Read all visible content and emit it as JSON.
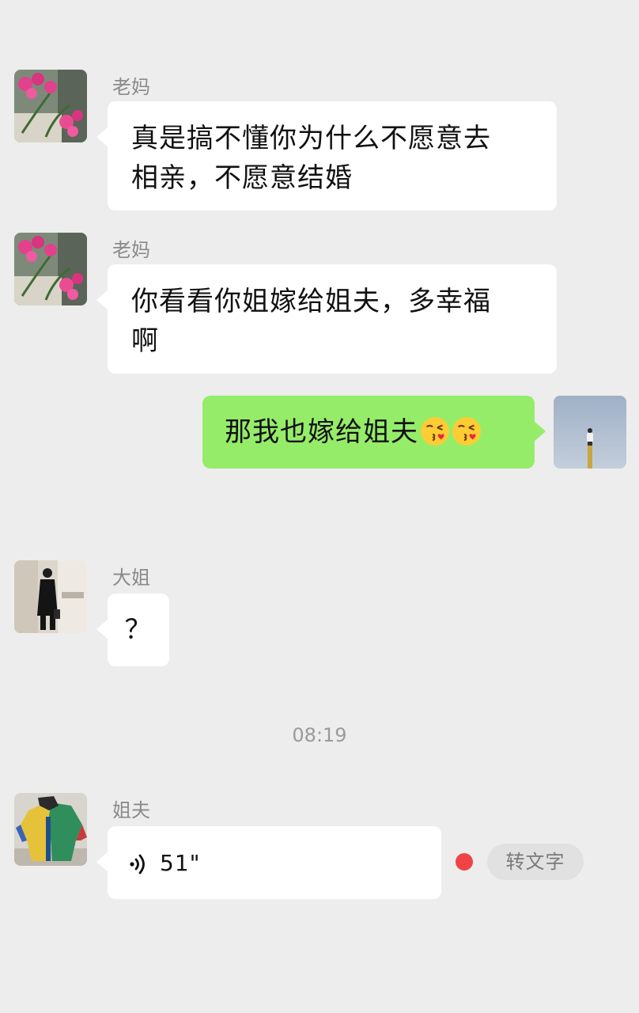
{
  "messages": [
    {
      "sender": "老妈",
      "avatar": "orchid-flowers-avatar",
      "lines": [
        "真是搞不懂你为什么不愿意去",
        "相亲，不愿意结婚"
      ]
    },
    {
      "sender": "老妈",
      "avatar": "orchid-flowers-avatar",
      "lines": [
        "你看看你姐嫁给姐夫，多幸福",
        "啊"
      ]
    },
    {
      "sender": "me",
      "avatar": "sky-figure-avatar",
      "text": "那我也嫁给姐夫",
      "emojis": [
        "kissing-face-emoji",
        "kissing-face-emoji"
      ]
    },
    {
      "sender": "大姐",
      "avatar": "woman-silhouette-avatar",
      "text": "？"
    },
    {
      "sender": "姐夫",
      "avatar": "colorful-jacket-avatar",
      "type": "voice",
      "duration": "51\"",
      "to_text_label": "转文字",
      "unread": true
    }
  ],
  "timestamp": "08:19",
  "colors": {
    "background": "#ededed",
    "bubble_in": "#ffffff",
    "bubble_out": "#95ec69",
    "unread_dot": "#f04444"
  }
}
